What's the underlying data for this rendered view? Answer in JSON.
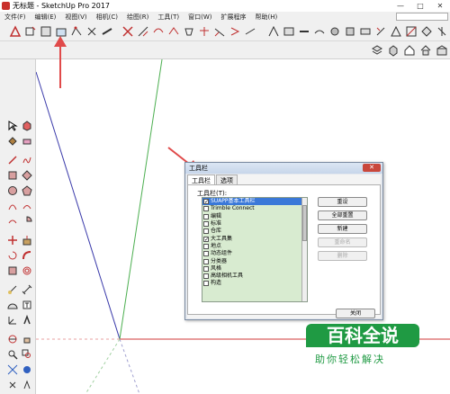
{
  "window": {
    "title": "无标题 - SketchUp Pro 2017",
    "controls": [
      "—",
      "□",
      "✕"
    ]
  },
  "menu": {
    "items": [
      "文件(F)",
      "编辑(E)",
      "视图(V)",
      "相机(C)",
      "绘图(R)",
      "工具(T)",
      "窗口(W)",
      "扩展程序",
      "帮助(H)"
    ]
  },
  "dialog": {
    "title": "工具栏",
    "close_label": "✕",
    "tabs": [
      "工具栏",
      "选项"
    ],
    "list_label": "工具栏(T):",
    "items": [
      {
        "label": "SUAPP基本工具栏",
        "checked": true,
        "selected": true
      },
      {
        "label": "Trimble Connect",
        "checked": false,
        "selected": false
      },
      {
        "label": "编辑",
        "checked": false,
        "selected": false
      },
      {
        "label": "标准",
        "checked": false,
        "selected": false
      },
      {
        "label": "仓库",
        "checked": false,
        "selected": false
      },
      {
        "label": "大工具集",
        "checked": true,
        "selected": false
      },
      {
        "label": "地点",
        "checked": false,
        "selected": false
      },
      {
        "label": "动态组件",
        "checked": false,
        "selected": false
      },
      {
        "label": "分类器",
        "checked": false,
        "selected": false
      },
      {
        "label": "风格",
        "checked": false,
        "selected": false
      },
      {
        "label": "高级相机工具",
        "checked": false,
        "selected": false
      },
      {
        "label": "构造",
        "checked": false,
        "selected": false
      }
    ],
    "buttons": {
      "reset": "重设",
      "reset_all": "全部重置",
      "new": "新建",
      "rename": "重命名",
      "delete": "删除",
      "close": "关闭"
    }
  },
  "watermark": {
    "logo": "百科全说",
    "slogan": "助你轻松解决"
  },
  "colors": {
    "axis_red": "#d23a3a",
    "axis_green": "#4caf50",
    "axis_blue": "#3a3aaa",
    "annotation_arrow": "#e04a4a"
  }
}
